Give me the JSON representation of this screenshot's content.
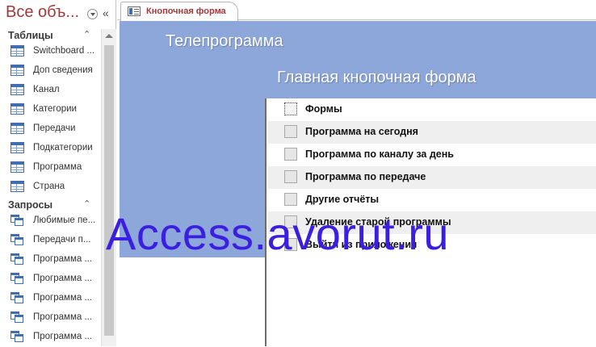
{
  "nav": {
    "title": "Все объ...",
    "groups": [
      {
        "label": "Таблицы",
        "items": [
          "Switchboard ...",
          "Доп сведения",
          "Канал",
          "Категории",
          "Передачи",
          "Подкатегории",
          "Программа",
          "Страна"
        ]
      },
      {
        "label": "Запросы",
        "items": [
          "Любимые пе...",
          "Передачи п...",
          "Программа ...",
          "Программа ...",
          "Программа ...",
          "Программа ...",
          "Программа ..."
        ]
      }
    ]
  },
  "tab": {
    "label": "Кнопочная форма"
  },
  "form": {
    "title": "Телепрограмма",
    "subtitle": "Главная кнопочная форма",
    "buttons": [
      "Формы",
      "Программа на сегодня",
      "Программа по каналу за день",
      "Программа по передаче",
      "Другие отчёты",
      "Удаление старой программы",
      "Выйти из приложения"
    ]
  },
  "watermark": "Access.avorut.ru",
  "colors": {
    "header": "#8ea7da",
    "accent": "#a4373a",
    "watermark": "#3b1fe0"
  }
}
